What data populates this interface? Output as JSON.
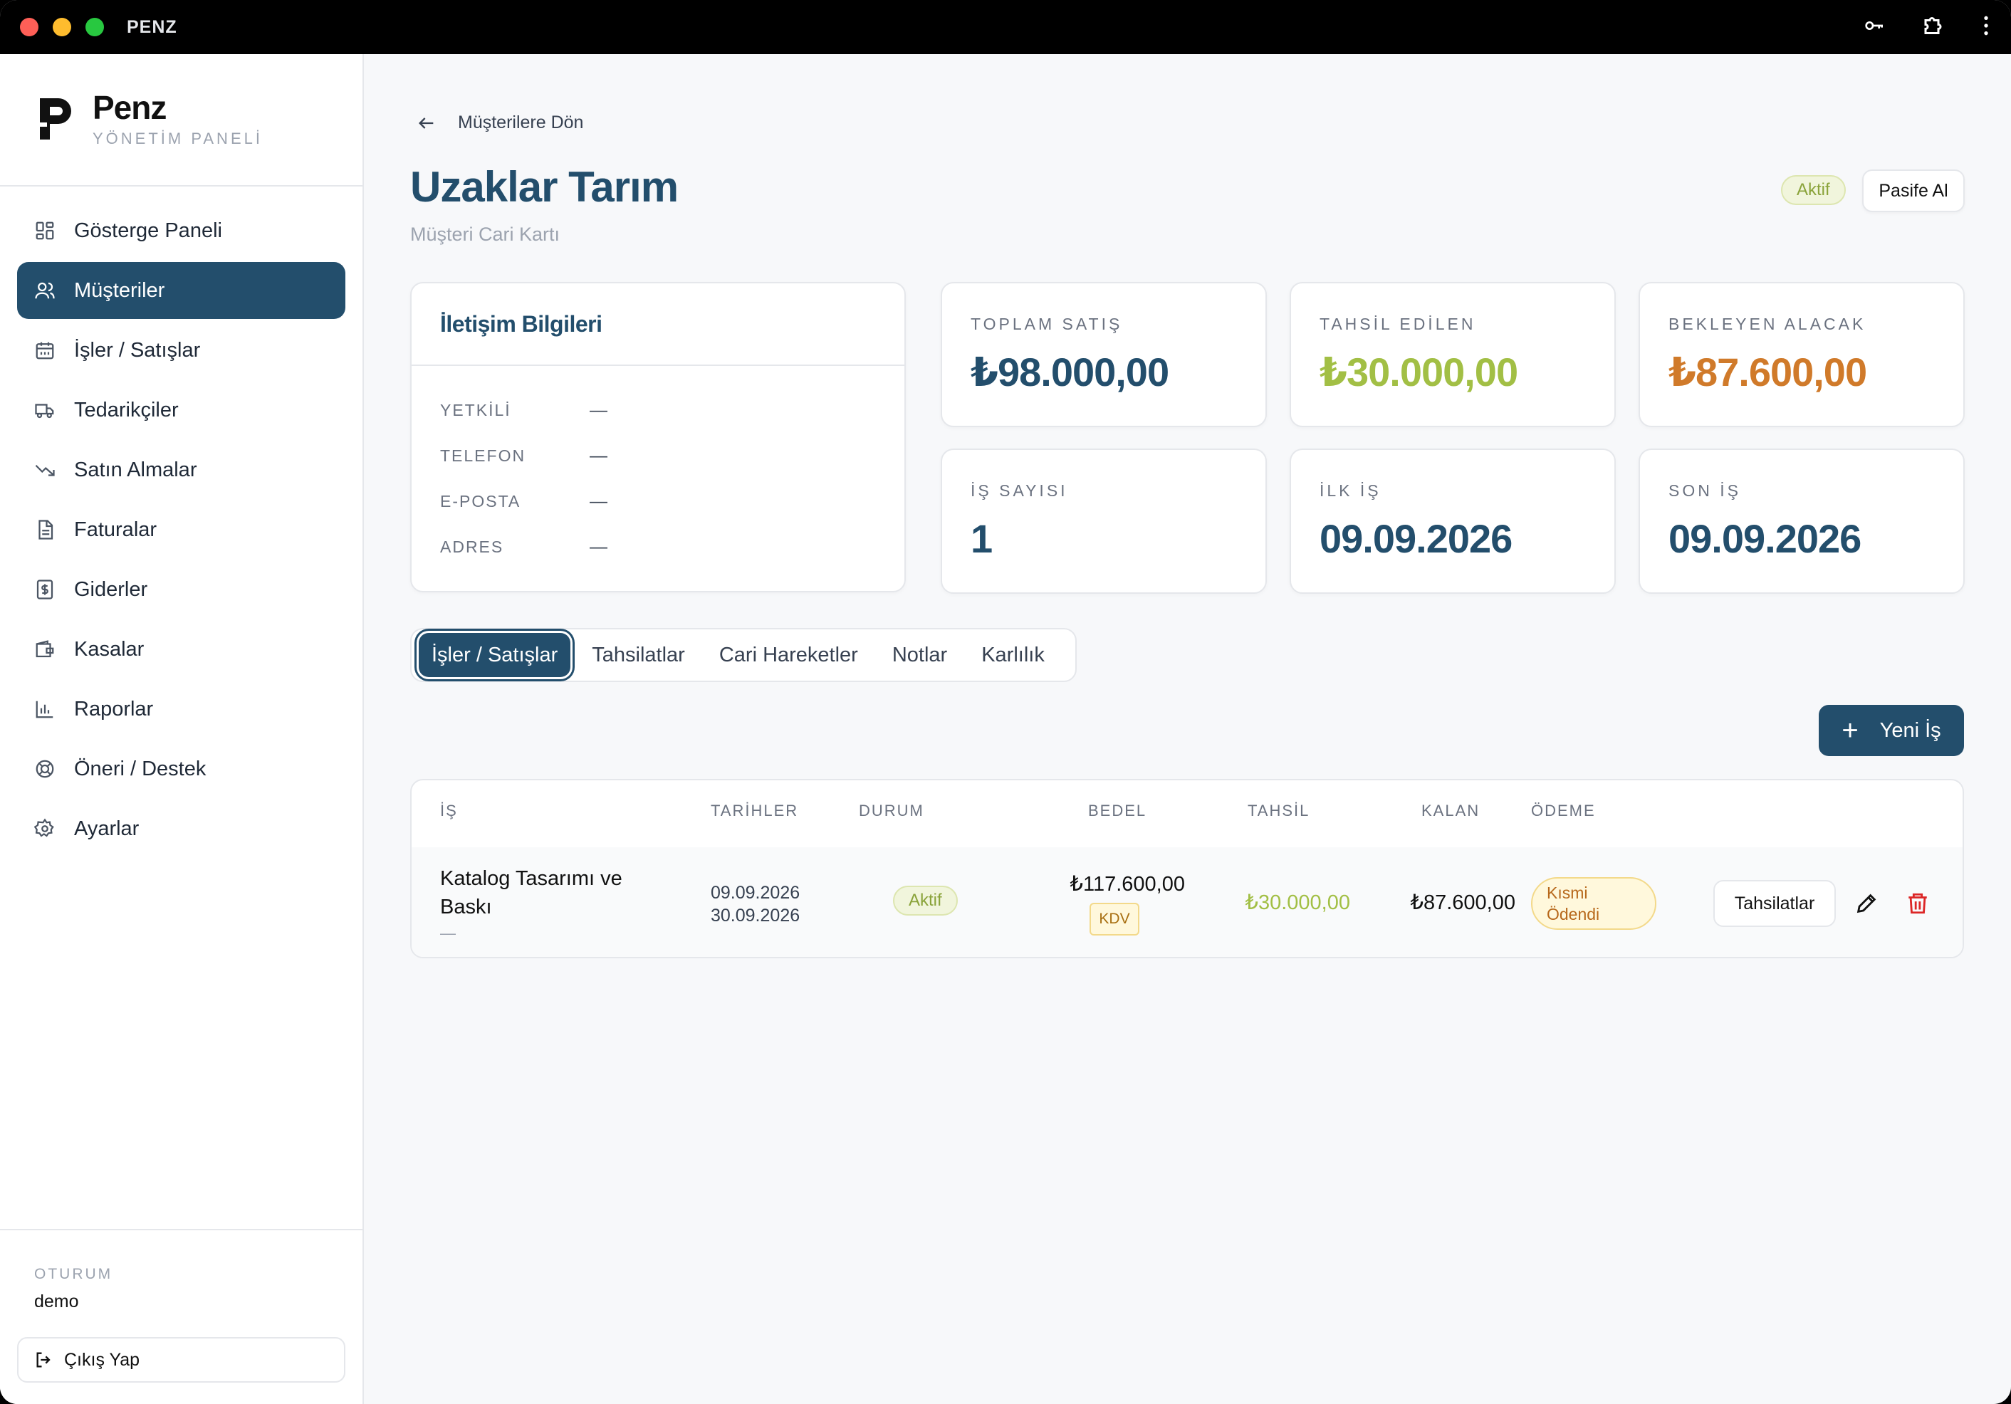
{
  "app": {
    "title": "PENZ"
  },
  "brand": {
    "name": "Penz",
    "subtitle": "YÖNETİM PANELİ"
  },
  "sidebar": {
    "items": [
      {
        "label": "Gösterge Paneli",
        "icon": "dashboard-icon"
      },
      {
        "label": "Müşteriler",
        "icon": "users-icon",
        "active": true
      },
      {
        "label": "İşler / Satışlar",
        "icon": "calendar-icon"
      },
      {
        "label": "Tedarikçiler",
        "icon": "truck-icon"
      },
      {
        "label": "Satın Almalar",
        "icon": "trending-down-icon"
      },
      {
        "label": "Faturalar",
        "icon": "file-icon"
      },
      {
        "label": "Giderler",
        "icon": "dollar-file-icon"
      },
      {
        "label": "Kasalar",
        "icon": "wallet-icon"
      },
      {
        "label": "Raporlar",
        "icon": "bar-chart-icon"
      },
      {
        "label": "Öneri / Destek",
        "icon": "lifebuoy-icon"
      },
      {
        "label": "Ayarlar",
        "icon": "gear-icon"
      }
    ]
  },
  "session": {
    "label": "OTURUM",
    "user": "demo",
    "logout_label": "Çıkış Yap"
  },
  "header": {
    "back_label": "Müşterilere Dön",
    "title": "Uzaklar Tarım",
    "subtitle": "Müşteri Cari Kartı",
    "status": "Aktif",
    "passive_button": "Pasife Al"
  },
  "contact": {
    "title": "İletişim Bilgileri",
    "rows": [
      {
        "key": "YETKİLİ",
        "value": "—"
      },
      {
        "key": "TELEFON",
        "value": "—"
      },
      {
        "key": "E-POSTA",
        "value": "—"
      },
      {
        "key": "ADRES",
        "value": "—"
      }
    ]
  },
  "stats": {
    "total_sales": {
      "label": "TOPLAM SATIŞ",
      "value": "₺98.000,00",
      "color": "#234e6c"
    },
    "collected": {
      "label": "TAHSİL EDİLEN",
      "value": "₺30.000,00",
      "color": "#a2bf45"
    },
    "pending": {
      "label": "BEKLEYEN ALACAK",
      "value": "₺87.600,00",
      "color": "#d07a2a"
    },
    "job_count": {
      "label": "İŞ SAYISI",
      "value": "1"
    },
    "first_job": {
      "label": "İLK İŞ",
      "value": "09.09.2026"
    },
    "last_job": {
      "label": "SON İŞ",
      "value": "09.09.2026"
    }
  },
  "tabs": [
    "İşler / Satışlar",
    "Tahsilatlar",
    "Cari Hareketler",
    "Notlar",
    "Karlılık"
  ],
  "new_job_button": "Yeni İş",
  "table": {
    "headers": {
      "job": "İŞ",
      "dates": "TARİHLER",
      "status": "DURUM",
      "amount": "BEDEL",
      "collected": "TAHSİL",
      "remaining": "KALAN",
      "payment": "ÖDEME"
    },
    "rows": [
      {
        "job_line1": "Katalog Tasarımı ve",
        "job_line2": "Baskı",
        "job_note": "—",
        "date_start": "09.09.2026",
        "date_end": "30.09.2026",
        "status": "Aktif",
        "amount": "₺117.600,00",
        "vat_badge": "KDV",
        "collected": "₺30.000,00",
        "remaining": "₺87.600,00",
        "payment_line1": "Kısmi",
        "payment_line2": "Ödendi",
        "collections_button": "Tahsilatlar"
      }
    ]
  }
}
